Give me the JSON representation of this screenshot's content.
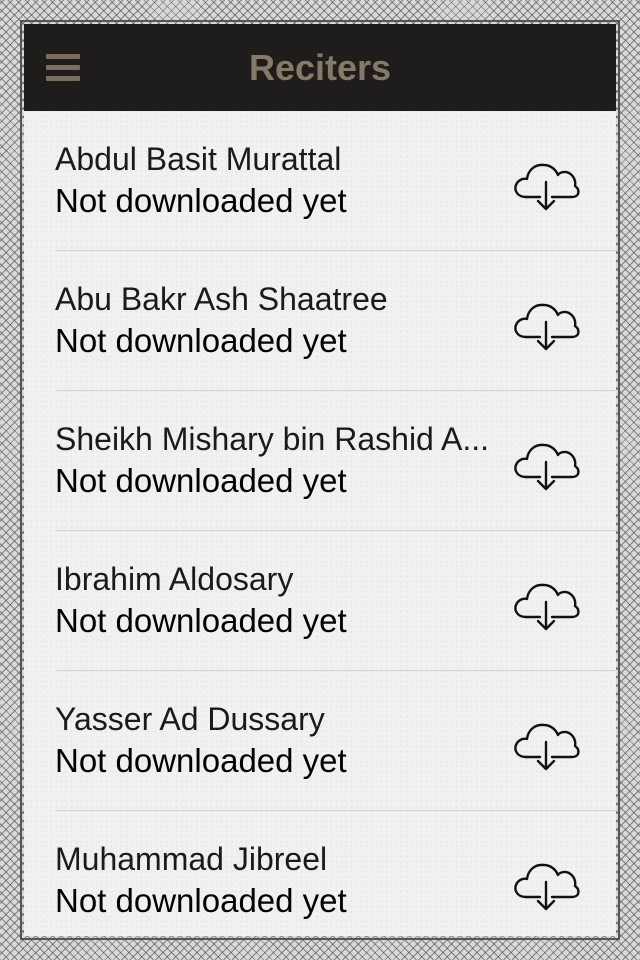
{
  "header": {
    "title": "Reciters",
    "menu_icon": "hamburger-menu-icon"
  },
  "reciters": [
    {
      "name": "Abdul Basit Murattal",
      "status": "Not downloaded yet",
      "icon": "cloud-download-icon"
    },
    {
      "name": "Abu Bakr Ash Shaatree",
      "status": "Not downloaded yet",
      "icon": "cloud-download-icon"
    },
    {
      "name": "Sheikh Mishary bin Rashid A...",
      "status": "Not downloaded yet",
      "icon": "cloud-download-icon"
    },
    {
      "name": "Ibrahim Aldosary",
      "status": "Not downloaded yet",
      "icon": "cloud-download-icon"
    },
    {
      "name": "Yasser Ad Dussary",
      "status": "Not downloaded yet",
      "icon": "cloud-download-icon"
    },
    {
      "name": "Muhammad Jibreel",
      "status": "Not downloaded yet",
      "icon": "cloud-download-icon"
    }
  ],
  "colors": {
    "header_background": "#1e1d1b",
    "header_accent": "#857a68",
    "list_background": "#f1f1f1"
  }
}
